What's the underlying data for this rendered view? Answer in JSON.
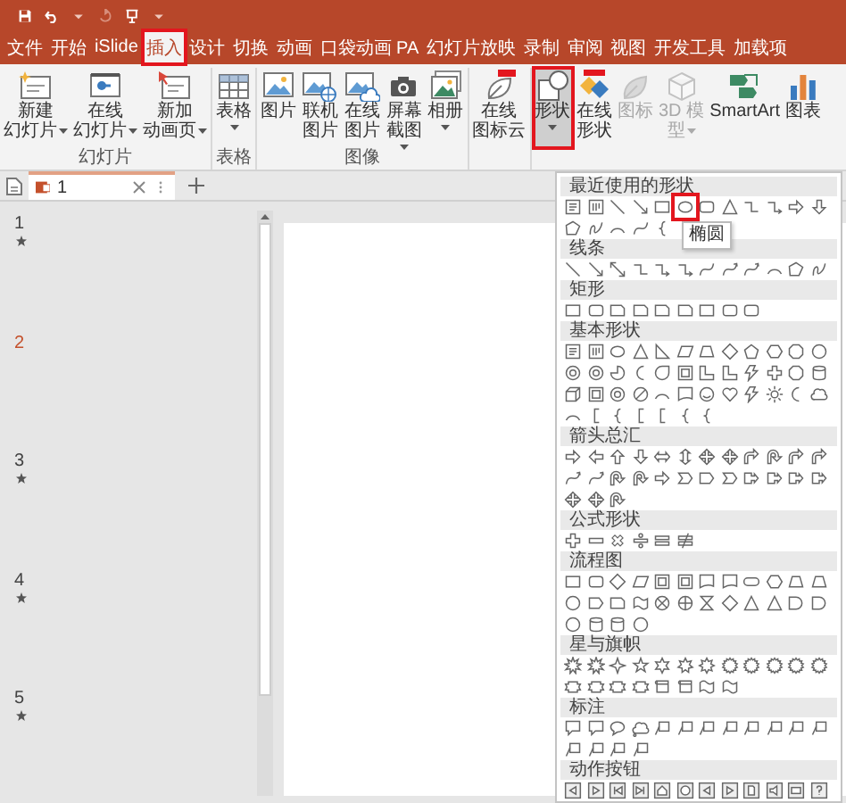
{
  "tabs": [
    {
      "label": "文件",
      "selected": false,
      "highlighted": false
    },
    {
      "label": "开始",
      "selected": false,
      "highlighted": false
    },
    {
      "label": "iSlide",
      "selected": false,
      "highlighted": false
    },
    {
      "label": "插入",
      "selected": true,
      "highlighted": true
    },
    {
      "label": "设计",
      "selected": false,
      "highlighted": false
    },
    {
      "label": "切换",
      "selected": false,
      "highlighted": false
    },
    {
      "label": "动画",
      "selected": false,
      "highlighted": false
    },
    {
      "label": "口袋动画 PA",
      "selected": false,
      "highlighted": false
    },
    {
      "label": "幻灯片放映",
      "selected": false,
      "highlighted": false
    },
    {
      "label": "录制",
      "selected": false,
      "highlighted": false
    },
    {
      "label": "审阅",
      "selected": false,
      "highlighted": false
    },
    {
      "label": "视图",
      "selected": false,
      "highlighted": false
    },
    {
      "label": "开发工具",
      "selected": false,
      "highlighted": false
    },
    {
      "label": "加载项",
      "selected": false,
      "highlighted": false
    }
  ],
  "ribbon": {
    "groups": [
      {
        "label": "幻灯片",
        "buttons": [
          {
            "kind": "new-slide",
            "lines": [
              "新建",
              "幻灯片"
            ],
            "dropdown": true,
            "disabled": false,
            "pressed": false,
            "highlighted": false
          },
          {
            "kind": "online-slide",
            "lines": [
              "在线",
              "幻灯片"
            ],
            "dropdown": true,
            "disabled": false,
            "pressed": false,
            "highlighted": false
          },
          {
            "kind": "animation-page",
            "lines": [
              "新加",
              "动画页"
            ],
            "dropdown": true,
            "disabled": false,
            "pressed": false,
            "highlighted": false
          }
        ]
      },
      {
        "label": "表格",
        "buttons": [
          {
            "kind": "table",
            "label": "表格",
            "dropdown": true,
            "disabled": false,
            "pressed": false,
            "highlighted": false
          }
        ]
      },
      {
        "label": "图像",
        "buttons": [
          {
            "kind": "picture",
            "label": "图片",
            "dropdown": false,
            "disabled": false,
            "pressed": false,
            "highlighted": false
          },
          {
            "kind": "online-picture",
            "label": "联机图片",
            "dropdown": false,
            "disabled": false,
            "pressed": false,
            "highlighted": false
          },
          {
            "kind": "cloud-picture",
            "label": "在线图片",
            "dropdown": false,
            "disabled": false,
            "pressed": false,
            "highlighted": false
          },
          {
            "kind": "screenshot",
            "label": "屏幕截图",
            "dropdown": true,
            "disabled": false,
            "pressed": false,
            "highlighted": false
          },
          {
            "kind": "album",
            "label": "相册",
            "dropdown": true,
            "disabled": false,
            "pressed": false,
            "highlighted": false
          }
        ]
      },
      {
        "buttons": [
          {
            "kind": "icon-cloud",
            "lines": [
              "在线",
              "图标云"
            ],
            "dropdown": false,
            "disabled": false,
            "pressed": false,
            "highlighted": false
          }
        ]
      },
      {
        "buttons": [
          {
            "kind": "shapes",
            "label": "形状",
            "dropdown": true,
            "disabled": false,
            "pressed": true,
            "highlighted": true
          },
          {
            "kind": "online-shapes",
            "label": "在线形状",
            "dropdown": false,
            "disabled": false,
            "pressed": false,
            "highlighted": false
          },
          {
            "kind": "icons",
            "label": "图标",
            "dropdown": false,
            "disabled": true,
            "pressed": false,
            "highlighted": false
          },
          {
            "kind": "model-3d",
            "lines": [
              "3D 模",
              "型"
            ],
            "dropdown": true,
            "disabled": true,
            "pressed": false,
            "highlighted": false
          },
          {
            "kind": "smartart",
            "label": "SmartArt",
            "dropdown": false,
            "disabled": false,
            "pressed": false,
            "highlighted": false
          },
          {
            "kind": "chart",
            "label": "图表",
            "dropdown": false,
            "disabled": false,
            "pressed": false,
            "highlighted": false
          }
        ]
      }
    ]
  },
  "document_tabs": [
    {
      "title": "1",
      "selected": true
    }
  ],
  "slides": [
    {
      "number": "1",
      "animated": true,
      "selected": false
    },
    {
      "number": "2",
      "animated": false,
      "selected": true
    },
    {
      "number": "3",
      "animated": true,
      "selected": false
    },
    {
      "number": "4",
      "animated": true,
      "selected": false
    },
    {
      "number": "5",
      "animated": true,
      "selected": false
    }
  ],
  "shapes_menu": {
    "sections": [
      {
        "title": "最近使用的形状",
        "shapes": [
          {
            "kind": "text-box",
            "hovered": false
          },
          {
            "kind": "vtext-box",
            "hovered": false
          },
          {
            "kind": "line",
            "hovered": false
          },
          {
            "kind": "arrow-line",
            "hovered": false
          },
          {
            "kind": "rect",
            "hovered": false
          },
          {
            "kind": "ellipse",
            "hovered": true,
            "tooltip": "椭圆"
          },
          {
            "kind": "round-rect",
            "hovered": false
          },
          {
            "kind": "triangle",
            "hovered": false
          },
          {
            "kind": "elbow",
            "hovered": false
          },
          {
            "kind": "elbow-arrow",
            "hovered": false
          },
          {
            "kind": "arrow-right",
            "hovered": false
          },
          {
            "kind": "arrow-down",
            "hovered": false
          },
          {
            "kind": "freeform",
            "hovered": false
          },
          {
            "kind": "scribble",
            "hovered": false
          },
          {
            "kind": "arc",
            "hovered": false
          },
          {
            "kind": "curve",
            "hovered": false
          },
          {
            "kind": "brace",
            "hovered": false
          }
        ]
      },
      {
        "title": "线条",
        "shapes": [
          {
            "kind": "line",
            "hovered": false
          },
          {
            "kind": "arrow-line",
            "hovered": false
          },
          {
            "kind": "double-arrow-line",
            "hovered": false
          },
          {
            "kind": "elbow",
            "hovered": false
          },
          {
            "kind": "elbow-arrow",
            "hovered": false
          },
          {
            "kind": "elbow-arrow",
            "hovered": false
          },
          {
            "kind": "curve",
            "hovered": false
          },
          {
            "kind": "curve-arrow",
            "hovered": false
          },
          {
            "kind": "curve-arrow",
            "hovered": false
          },
          {
            "kind": "arc",
            "hovered": false
          },
          {
            "kind": "freeform",
            "hovered": false
          },
          {
            "kind": "scribble",
            "hovered": false
          }
        ]
      },
      {
        "title": "矩形",
        "shapes": [
          {
            "kind": "rect",
            "hovered": false
          },
          {
            "kind": "round-rect",
            "hovered": false
          },
          {
            "kind": "snip-rect",
            "hovered": false
          },
          {
            "kind": "snip-rect",
            "hovered": false
          },
          {
            "kind": "snip-rect",
            "hovered": false
          },
          {
            "kind": "snip-rect",
            "hovered": false
          },
          {
            "kind": "rect",
            "hovered": false
          },
          {
            "kind": "round-rect",
            "hovered": false
          },
          {
            "kind": "round-rect",
            "hovered": false
          }
        ]
      },
      {
        "title": "基本形状",
        "shapes": [
          {
            "kind": "text-box",
            "hovered": false
          },
          {
            "kind": "vtext-box",
            "hovered": false
          },
          {
            "kind": "ellipse",
            "hovered": false
          },
          {
            "kind": "triangle",
            "hovered": false
          },
          {
            "kind": "rtriangle",
            "hovered": false
          },
          {
            "kind": "parallelogram",
            "hovered": false
          },
          {
            "kind": "trapezoid",
            "hovered": false
          },
          {
            "kind": "diamond",
            "hovered": false
          },
          {
            "kind": "pentagon",
            "hovered": false
          },
          {
            "kind": "hexagon",
            "hovered": false
          },
          {
            "kind": "octagon",
            "hovered": false
          },
          {
            "kind": "circle",
            "hovered": false
          },
          {
            "kind": "donut",
            "hovered": false
          },
          {
            "kind": "donut",
            "hovered": false
          },
          {
            "kind": "pie",
            "hovered": false
          },
          {
            "kind": "moon",
            "hovered": false
          },
          {
            "kind": "teardrop",
            "hovered": false
          },
          {
            "kind": "frame",
            "hovered": false
          },
          {
            "kind": "l-shape",
            "hovered": false
          },
          {
            "kind": "l-shape",
            "hovered": false
          },
          {
            "kind": "lightning",
            "hovered": false
          },
          {
            "kind": "plus",
            "hovered": false
          },
          {
            "kind": "octagon",
            "hovered": false
          },
          {
            "kind": "cylinder",
            "hovered": false
          },
          {
            "kind": "cube",
            "hovered": false
          },
          {
            "kind": "frame",
            "hovered": false
          },
          {
            "kind": "donut",
            "hovered": false
          },
          {
            "kind": "no-symbol",
            "hovered": false
          },
          {
            "kind": "arc",
            "hovered": false
          },
          {
            "kind": "document",
            "hovered": false
          },
          {
            "kind": "smiley",
            "hovered": false
          },
          {
            "kind": "heart",
            "hovered": false
          },
          {
            "kind": "lightning",
            "hovered": false
          },
          {
            "kind": "sun",
            "hovered": false
          },
          {
            "kind": "moon",
            "hovered": false
          },
          {
            "kind": "cloud",
            "hovered": false
          },
          {
            "kind": "arc",
            "hovered": false
          },
          {
            "kind": "bracket",
            "hovered": false
          },
          {
            "kind": "brace",
            "hovered": false
          },
          {
            "kind": "bracket",
            "hovered": false
          },
          {
            "kind": "bracket",
            "hovered": false
          },
          {
            "kind": "brace",
            "hovered": false
          },
          {
            "kind": "brace",
            "hovered": false
          }
        ]
      },
      {
        "title": "箭头总汇",
        "shapes": [
          {
            "kind": "arrow-right",
            "hovered": false
          },
          {
            "kind": "arrow-left",
            "hovered": false
          },
          {
            "kind": "arrow-up",
            "hovered": false
          },
          {
            "kind": "arrow-down",
            "hovered": false
          },
          {
            "kind": "arrow-lr",
            "hovered": false
          },
          {
            "kind": "arrow-ud",
            "hovered": false
          },
          {
            "kind": "arrow-quad",
            "hovered": false
          },
          {
            "kind": "arrow-quad",
            "hovered": false
          },
          {
            "kind": "bent-arrow",
            "hovered": false
          },
          {
            "kind": "u-turn",
            "hovered": false
          },
          {
            "kind": "bent-arrow",
            "hovered": false
          },
          {
            "kind": "bent-arrow",
            "hovered": false
          },
          {
            "kind": "curve-arrow",
            "hovered": false
          },
          {
            "kind": "curve-arrow",
            "hovered": false
          },
          {
            "kind": "u-turn",
            "hovered": false
          },
          {
            "kind": "u-turn",
            "hovered": false
          },
          {
            "kind": "arrow-right",
            "hovered": false
          },
          {
            "kind": "chevron",
            "hovered": false
          },
          {
            "kind": "home-plate",
            "hovered": false
          },
          {
            "kind": "chevron",
            "hovered": false
          },
          {
            "kind": "callout-arrow",
            "hovered": false
          },
          {
            "kind": "callout-arrow",
            "hovered": false
          },
          {
            "kind": "callout-arrow",
            "hovered": false
          },
          {
            "kind": "callout-arrow",
            "hovered": false
          },
          {
            "kind": "arrow-quad",
            "hovered": false
          },
          {
            "kind": "arrow-quad",
            "hovered": false
          },
          {
            "kind": "u-turn",
            "hovered": false
          }
        ]
      },
      {
        "title": "公式形状",
        "shapes": [
          {
            "kind": "plus",
            "hovered": false
          },
          {
            "kind": "minus",
            "hovered": false
          },
          {
            "kind": "multiply",
            "hovered": false
          },
          {
            "kind": "divide",
            "hovered": false
          },
          {
            "kind": "equal",
            "hovered": false
          },
          {
            "kind": "not-equal",
            "hovered": false
          }
        ]
      },
      {
        "title": "流程图",
        "shapes": [
          {
            "kind": "rect",
            "hovered": false
          },
          {
            "kind": "round-rect",
            "hovered": false
          },
          {
            "kind": "diamond",
            "hovered": false
          },
          {
            "kind": "parallelogram",
            "hovered": false
          },
          {
            "kind": "frame",
            "hovered": false
          },
          {
            "kind": "frame",
            "hovered": false
          },
          {
            "kind": "document",
            "hovered": false
          },
          {
            "kind": "document",
            "hovered": false
          },
          {
            "kind": "terminator",
            "hovered": false
          },
          {
            "kind": "hexagon",
            "hovered": false
          },
          {
            "kind": "trapezoid",
            "hovered": false
          },
          {
            "kind": "trapezoid",
            "hovered": false
          },
          {
            "kind": "circle",
            "hovered": false
          },
          {
            "kind": "home-plate",
            "hovered": false
          },
          {
            "kind": "snip-rect",
            "hovered": false
          },
          {
            "kind": "tape",
            "hovered": false
          },
          {
            "kind": "circle-cross",
            "hovered": false
          },
          {
            "kind": "circle-plus",
            "hovered": false
          },
          {
            "kind": "hourglass",
            "hovered": false
          },
          {
            "kind": "diamond",
            "hovered": false
          },
          {
            "kind": "triangle",
            "hovered": false
          },
          {
            "kind": "triangle",
            "hovered": false
          },
          {
            "kind": "delay",
            "hovered": false
          },
          {
            "kind": "delay",
            "hovered": false
          },
          {
            "kind": "circle",
            "hovered": false
          },
          {
            "kind": "cylinder",
            "hovered": false
          },
          {
            "kind": "cylinder",
            "hovered": false
          },
          {
            "kind": "circle",
            "hovered": false
          }
        ]
      },
      {
        "title": "星与旗帜",
        "shapes": [
          {
            "kind": "explosion",
            "hovered": false
          },
          {
            "kind": "explosion",
            "hovered": false
          },
          {
            "kind": "star4",
            "hovered": false
          },
          {
            "kind": "star5",
            "hovered": false
          },
          {
            "kind": "star6",
            "hovered": false
          },
          {
            "kind": "star7",
            "hovered": false
          },
          {
            "kind": "star8",
            "hovered": false
          },
          {
            "kind": "star-burst",
            "hovered": false
          },
          {
            "kind": "star-burst",
            "hovered": false
          },
          {
            "kind": "star-burst",
            "hovered": false
          },
          {
            "kind": "star-burst",
            "hovered": false
          },
          {
            "kind": "star-burst",
            "hovered": false
          },
          {
            "kind": "ribbon",
            "hovered": false
          },
          {
            "kind": "ribbon",
            "hovered": false
          },
          {
            "kind": "ribbon",
            "hovered": false
          },
          {
            "kind": "ribbon",
            "hovered": false
          },
          {
            "kind": "scroll",
            "hovered": false
          },
          {
            "kind": "scroll",
            "hovered": false
          },
          {
            "kind": "wave",
            "hovered": false
          },
          {
            "kind": "wave",
            "hovered": false
          }
        ]
      },
      {
        "title": "标注",
        "shapes": [
          {
            "kind": "callout-rect",
            "hovered": false
          },
          {
            "kind": "callout-rect",
            "hovered": false
          },
          {
            "kind": "callout-round",
            "hovered": false
          },
          {
            "kind": "callout-cloud",
            "hovered": false
          },
          {
            "kind": "callout-line",
            "hovered": false
          },
          {
            "kind": "callout-line",
            "hovered": false
          },
          {
            "kind": "callout-line",
            "hovered": false
          },
          {
            "kind": "callout-line",
            "hovered": false
          },
          {
            "kind": "callout-line",
            "hovered": false
          },
          {
            "kind": "callout-line",
            "hovered": false
          },
          {
            "kind": "callout-line",
            "hovered": false
          },
          {
            "kind": "callout-line",
            "hovered": false
          },
          {
            "kind": "callout-line",
            "hovered": false
          },
          {
            "kind": "callout-line",
            "hovered": false
          },
          {
            "kind": "callout-line",
            "hovered": false
          },
          {
            "kind": "callout-line",
            "hovered": false
          }
        ]
      },
      {
        "title": "动作按钮",
        "shapes": [
          {
            "kind": "action-back",
            "hovered": false
          },
          {
            "kind": "action-forward",
            "hovered": false
          },
          {
            "kind": "action-begin",
            "hovered": false
          },
          {
            "kind": "action-end",
            "hovered": false
          },
          {
            "kind": "action-home",
            "hovered": false
          },
          {
            "kind": "action-info",
            "hovered": false
          },
          {
            "kind": "action-back",
            "hovered": false
          },
          {
            "kind": "action-forward",
            "hovered": false
          },
          {
            "kind": "action-doc",
            "hovered": false
          },
          {
            "kind": "action-sound",
            "hovered": false
          },
          {
            "kind": "action-movie",
            "hovered": false
          },
          {
            "kind": "action-help",
            "hovered": false
          }
        ]
      }
    ]
  }
}
